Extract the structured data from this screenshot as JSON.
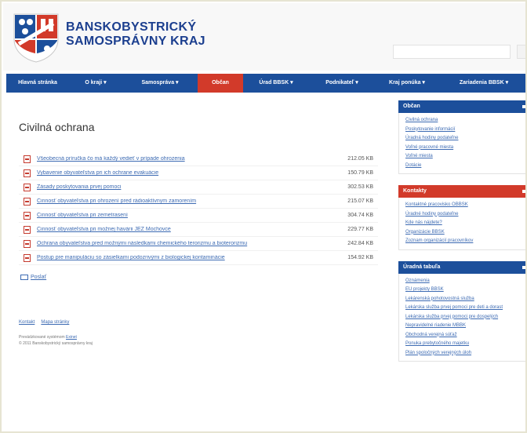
{
  "header": {
    "brand_line1": "BANSKOBYSTRICKÝ",
    "brand_line2": "SAMOSPRÁVNY KRAJ"
  },
  "nav": {
    "items": [
      {
        "label": "Hlavná stránka",
        "active": false
      },
      {
        "label": "O kraji ▾",
        "active": false
      },
      {
        "label": "Samospráva ▾",
        "active": false
      },
      {
        "label": "Občan",
        "active": true
      },
      {
        "label": "Úrad BBSK ▾",
        "active": false
      },
      {
        "label": "Podnikateľ ▾",
        "active": false
      },
      {
        "label": "Kraj ponúka ▾",
        "active": false
      },
      {
        "label": "Zariadenia BBSK ▾",
        "active": false
      }
    ]
  },
  "main": {
    "title": "Civilná ochrana",
    "documents": [
      {
        "name": "Všeobecná príručka čo má každý vedieť v prípade ohrozenia",
        "size": "212.05 KB"
      },
      {
        "name": "Vybavenie obyvateľstva pri ich ochrane evakuácie",
        "size": "150.79 KB"
      },
      {
        "name": "Zásady poskytovania prvej pomoci",
        "size": "302.53 KB"
      },
      {
        "name": "Činnosť obyvateľstva pri ohrození pred rádioaktívnym zamorením",
        "size": "215.07 KB"
      },
      {
        "name": "Činnosť obyvateľstva pri zemetrasení",
        "size": "304.74 KB"
      },
      {
        "name": "Činnosť obyvateľstva pri možnej havárii JEZ Mochovce",
        "size": "229.77 KB"
      },
      {
        "name": "Ochrana obyvateľstva pred možnými následkami chemického terorizmu a bioterorizmu",
        "size": "242.84 KB"
      },
      {
        "name": "Postup pre manipuláciu so zásielkami podozrivými z biologickej kontaminácie",
        "size": "154.92 KB"
      }
    ],
    "send_label": "Poslať",
    "footer_links": [
      "Kontakt",
      "Mapa stránky"
    ],
    "powered_text": "Prevádzkované systémom",
    "powered_link": "Exinet",
    "copyright": "© 2011 Banskobystrický samosprávny kraj"
  },
  "sidebar": {
    "boxes": [
      {
        "title": "Občan",
        "color": "blue",
        "links": [
          "Civilná ochrana",
          "Poskytovanie informácií",
          "Úradná hodiny podateľne",
          "Voľné pracovné miesta",
          "Voľné miesta",
          "Dotácie"
        ]
      },
      {
        "title": "Kontakty",
        "color": "red",
        "links": [
          "Kontaktné pracovisko OBBSK",
          "Úradné hodiny podateľne",
          "Kde nás nájdete?",
          "Organizácie BBSK",
          "Zoznam organizácií pracovníkov"
        ]
      },
      {
        "title": "Úradná tabuľa",
        "color": "blue",
        "links": [
          "Oznámenia",
          "EU projekty BBSK",
          "Lekárenská pohotovostná služba",
          "Lekárska služba prvej pomoci pre deti a dorast",
          "Lekárska služba prvej pomoci pre dospelých",
          "Nepravidelné riadenie MBBK",
          "Obchodná verejná súťaž",
          "Ponuka prebytočného majetku",
          "Plán spoločných verejných úloh"
        ]
      }
    ]
  },
  "colors": {
    "nav_blue": "#1c4f9b",
    "nav_active_red": "#d23a2a",
    "brand_blue": "#1c3f8f",
    "link_blue": "#3d6bb3"
  }
}
